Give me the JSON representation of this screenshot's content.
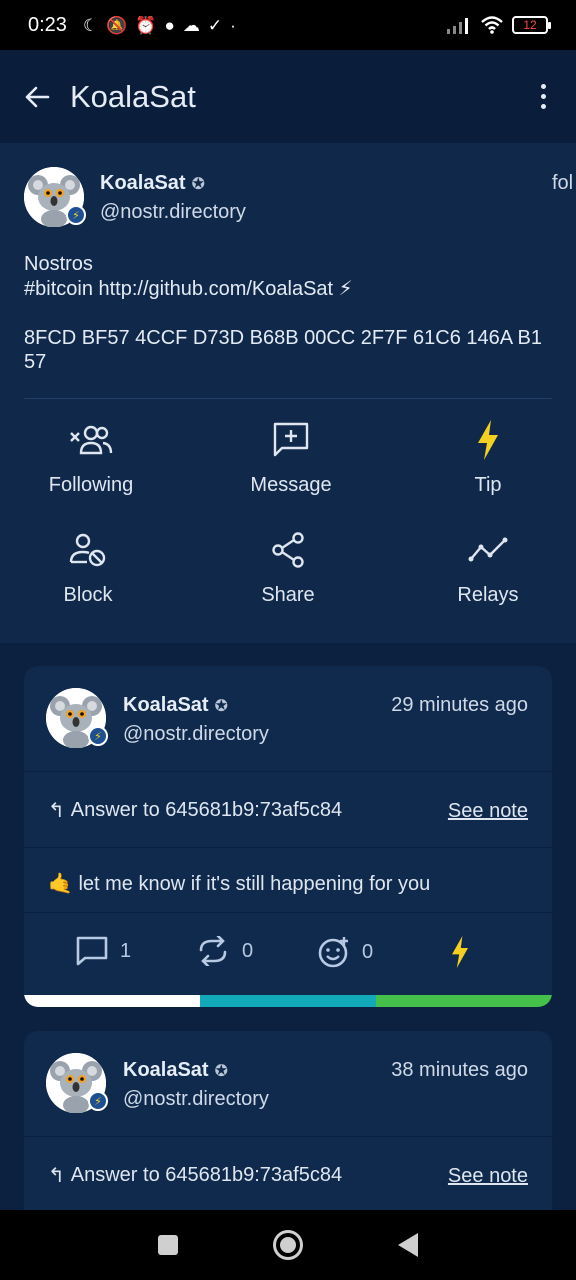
{
  "status_bar": {
    "time": "0:23",
    "icons": [
      "moon-icon",
      "mute-icon",
      "alarm-icon",
      "chat-icon",
      "cloud-icon",
      "check-icon",
      "dot-icon"
    ],
    "battery": "12"
  },
  "app_bar": {
    "title": "KoalaSat"
  },
  "profile": {
    "name": "KoalaSat",
    "handle": "@nostr.directory",
    "partial_text": "fol",
    "bio": "Nostros\n#bitcoin http://github.com/KoalaSat ⚡",
    "fingerprint": "8FCD BF57 4CCF D73D B68B  00CC 2F7F 61C6 146A B1 57",
    "actions": [
      {
        "label": "Following",
        "icon": "following-icon"
      },
      {
        "label": "Message",
        "icon": "message-icon"
      },
      {
        "label": "Tip",
        "icon": "lightning-icon"
      },
      {
        "label": "Block",
        "icon": "block-user-icon"
      },
      {
        "label": "Share",
        "icon": "share-icon"
      },
      {
        "label": "Relays",
        "icon": "relays-icon"
      }
    ]
  },
  "notes": [
    {
      "name": "KoalaSat",
      "handle": "@nostr.directory",
      "time": "29 minutes ago",
      "answer": "Answer to 645681b9:73af5c84",
      "see_note": "See note",
      "content": "🤙 let me know if it's still happening for you",
      "replies": "1",
      "reposts": "0",
      "reactions": "0"
    },
    {
      "name": "KoalaSat",
      "handle": "@nostr.directory",
      "time": "38 minutes ago",
      "answer": "Answer to 645681b9:73af5c84",
      "see_note": "See note"
    }
  ],
  "colors": {
    "background": "#0c213f",
    "profile_bg": "#10294a",
    "card_bg": "#0f2a4c",
    "lightning": "#f5d020",
    "relay_bar": [
      "#ffffff",
      "#12a9b8",
      "#45c14b"
    ]
  }
}
